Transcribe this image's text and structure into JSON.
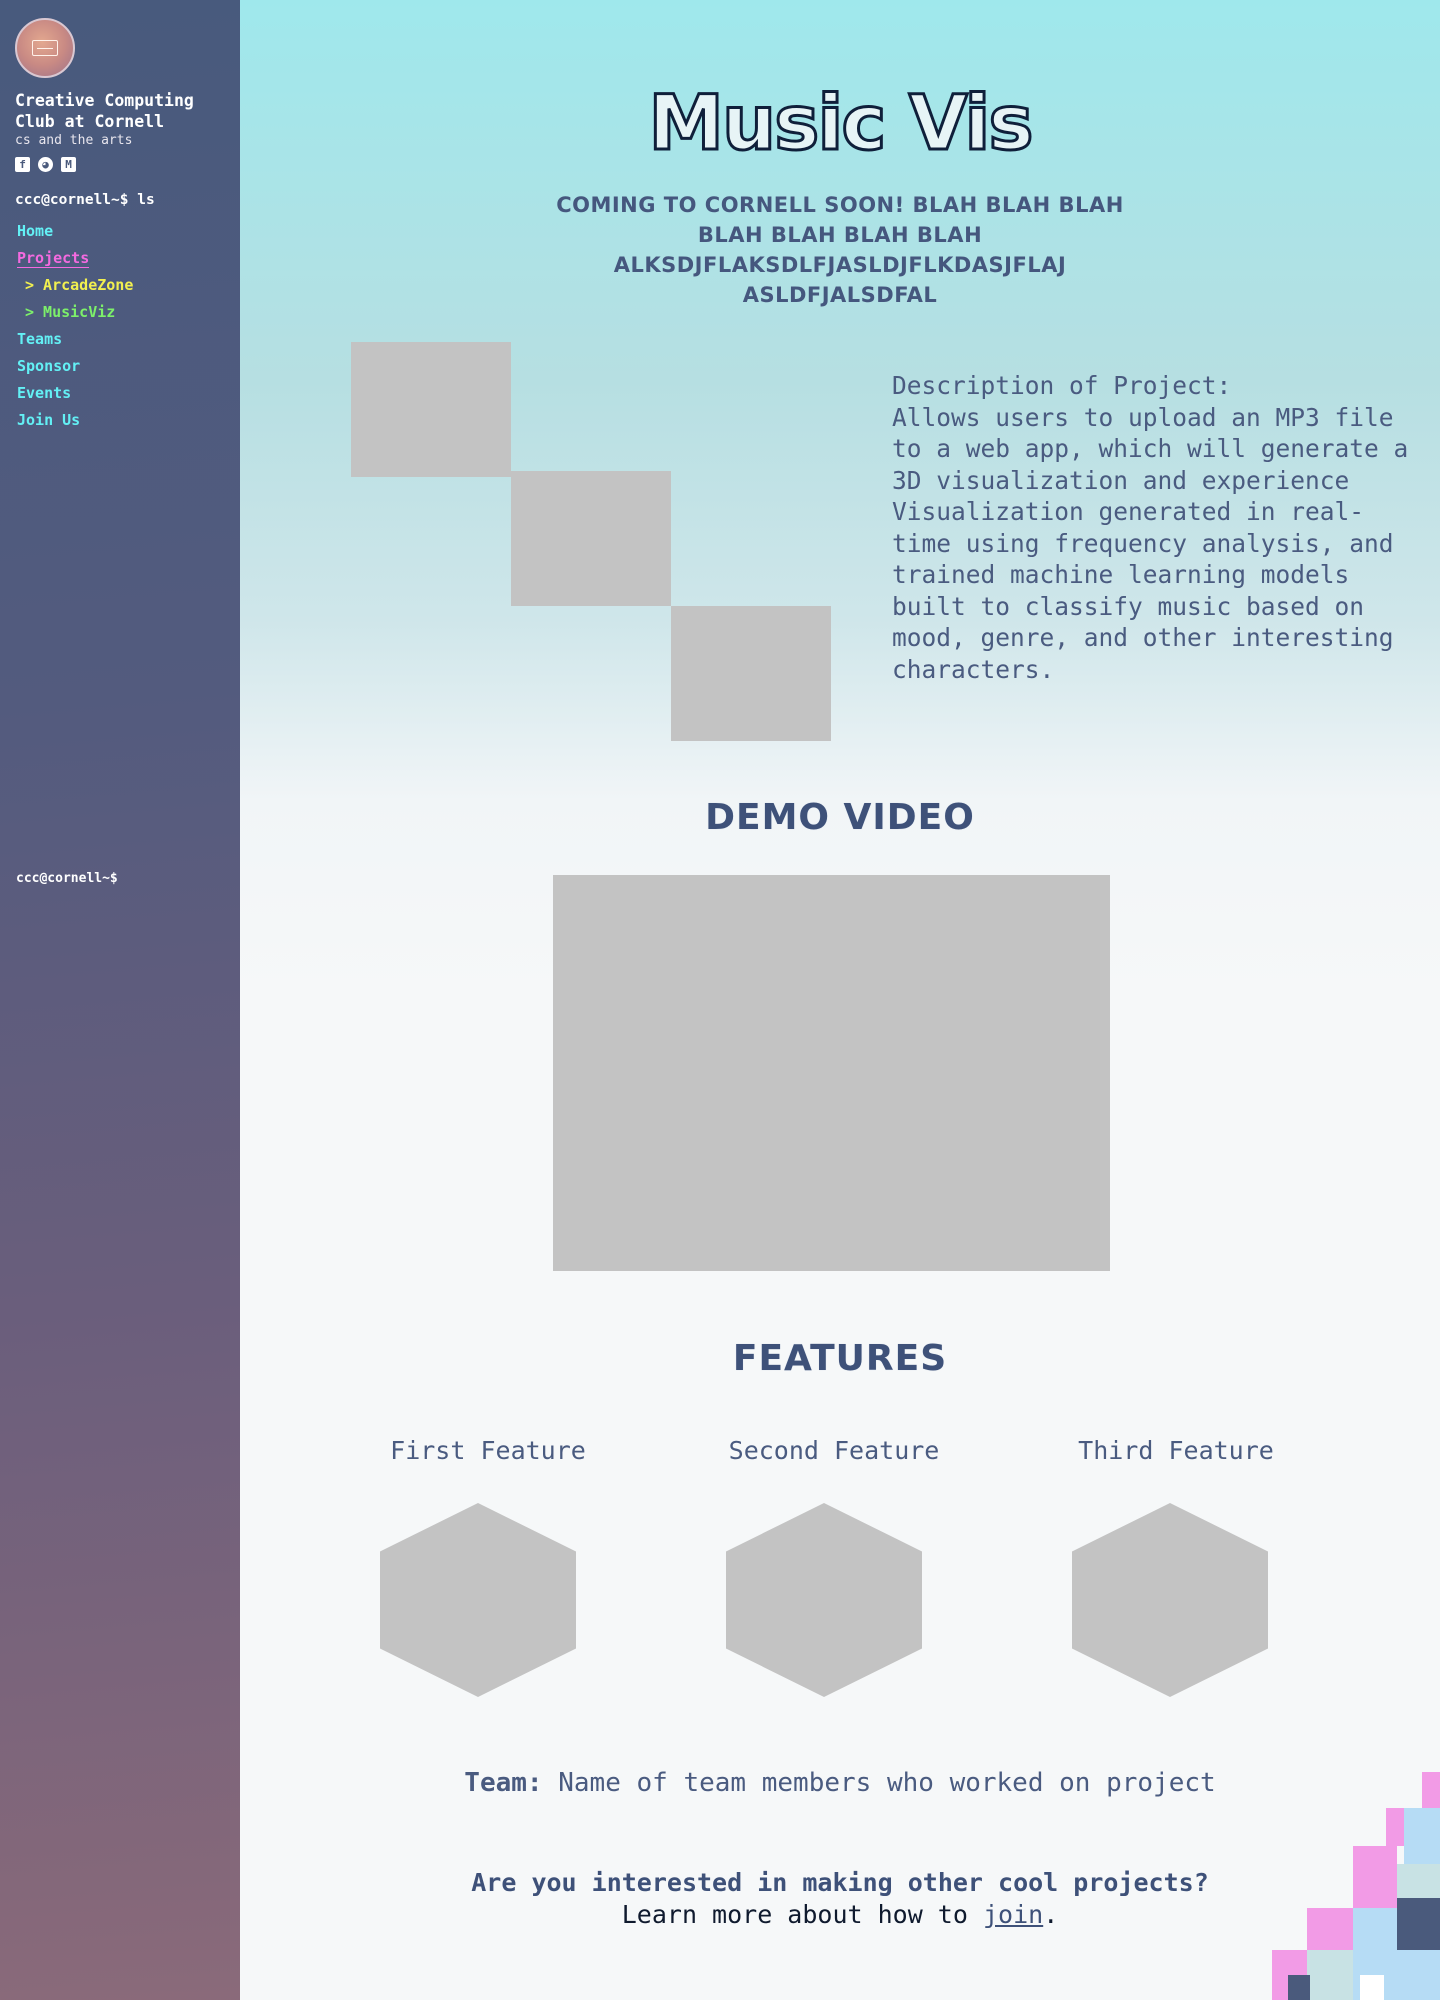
{
  "sidebar": {
    "club_name": "Creative Computing Club at Cornell",
    "tagline": "cs and the arts",
    "social_icons": [
      "facebook-icon",
      "github-icon",
      "medium-icon"
    ],
    "prompt": "ccc@cornell~$ ls",
    "nav": [
      {
        "label": "Home"
      },
      {
        "label": "Projects"
      },
      {
        "label": "> ArcadeZone"
      },
      {
        "label": "> MusicViz"
      },
      {
        "label": "Teams"
      },
      {
        "label": "Sponsor"
      },
      {
        "label": "Events"
      },
      {
        "label": "Join Us"
      }
    ],
    "prompt_bottom": "ccc@cornell~$"
  },
  "main": {
    "title": "Music Vis",
    "subtitle": "Coming to Cornell Soon! Blah blah blah blah blah blah blah alksdjflaksdlfjasldjflkdasjflaj asldfjalsdfal",
    "description_heading": "Description of Project:",
    "description_p1": "Allows users to upload an MP3 file to a web app, which will generate a 3D visualization and experience",
    "description_p2": "Visualization generated in real-time using frequency analysis, and trained machine learning models built to classify music based on mood, genre, and other interesting characters.",
    "demo_heading": "DEMO VIDEO",
    "features_heading": "FEATURES",
    "features": [
      {
        "label": "First Feature"
      },
      {
        "label": "Second Feature"
      },
      {
        "label": "Third Feature"
      }
    ],
    "team_label": "Team:",
    "team_text": "Name of team members who worked on project",
    "cta_question": "Are you interested in making other cool projects?",
    "cta_text": "Learn more about how to",
    "cta_link": "join",
    "cta_end": "."
  },
  "colors": {
    "sidebar_top": "#485a7d",
    "sidebar_bottom": "#8a6a7a",
    "nav_link": "#63f0f5",
    "nav_active": "#f46ae0",
    "nav_sub1": "#f2f04f",
    "nav_sub2": "#7df06a",
    "heading": "#3e5179",
    "placeholder": "#c3c3c3"
  }
}
